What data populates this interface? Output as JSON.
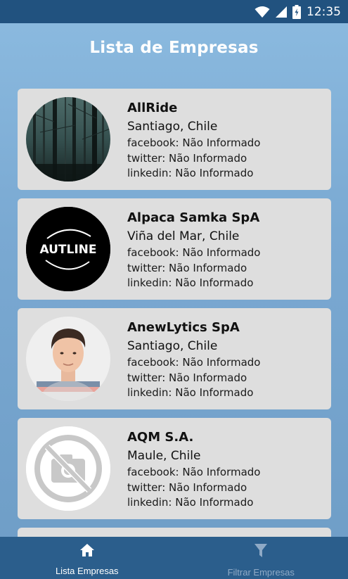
{
  "status_bar": {
    "time": "12:35",
    "icons": [
      "wifi-icon",
      "signal-icon",
      "battery-icon"
    ]
  },
  "header": {
    "title": "Lista de Empresas"
  },
  "companies": [
    {
      "name": "AllRide",
      "city": "Santiago, Chile",
      "facebook": "facebook: Não Informado",
      "twitter": "twitter: Não Informado",
      "linkedin": "linkedin: Não Informado",
      "avatar": "forest-photo"
    },
    {
      "name": "Alpaca Samka SpA",
      "city": "Viña del Mar, Chile",
      "facebook": "facebook: Não Informado",
      "twitter": "twitter: Não Informado",
      "linkedin": "linkedin: Não Informado",
      "avatar": "autline-logo",
      "logo_text": "AUTLINE"
    },
    {
      "name": "AnewLytics SpA",
      "city": "Santiago, Chile",
      "facebook": "facebook: Não Informado",
      "twitter": "twitter: Não Informado",
      "linkedin": "linkedin: Não Informado",
      "avatar": "person-photo"
    },
    {
      "name": "AQM S.A.",
      "city": "Maule, Chile",
      "facebook": "facebook: Não Informado",
      "twitter": "twitter: Não Informado",
      "linkedin": "linkedin: Não Informado",
      "avatar": "no-photo-icon"
    }
  ],
  "bottom_nav": [
    {
      "label": "Lista Empresas",
      "icon": "home-icon",
      "active": true
    },
    {
      "label": "Filtrar Empresas",
      "icon": "filter-icon",
      "active": false
    }
  ],
  "colors": {
    "status_bar": "#21527f",
    "bottom_nav": "#2b5e8c",
    "card": "#dedede",
    "background_top": "#8cbbe0",
    "background_bottom": "#6e9dc6"
  }
}
